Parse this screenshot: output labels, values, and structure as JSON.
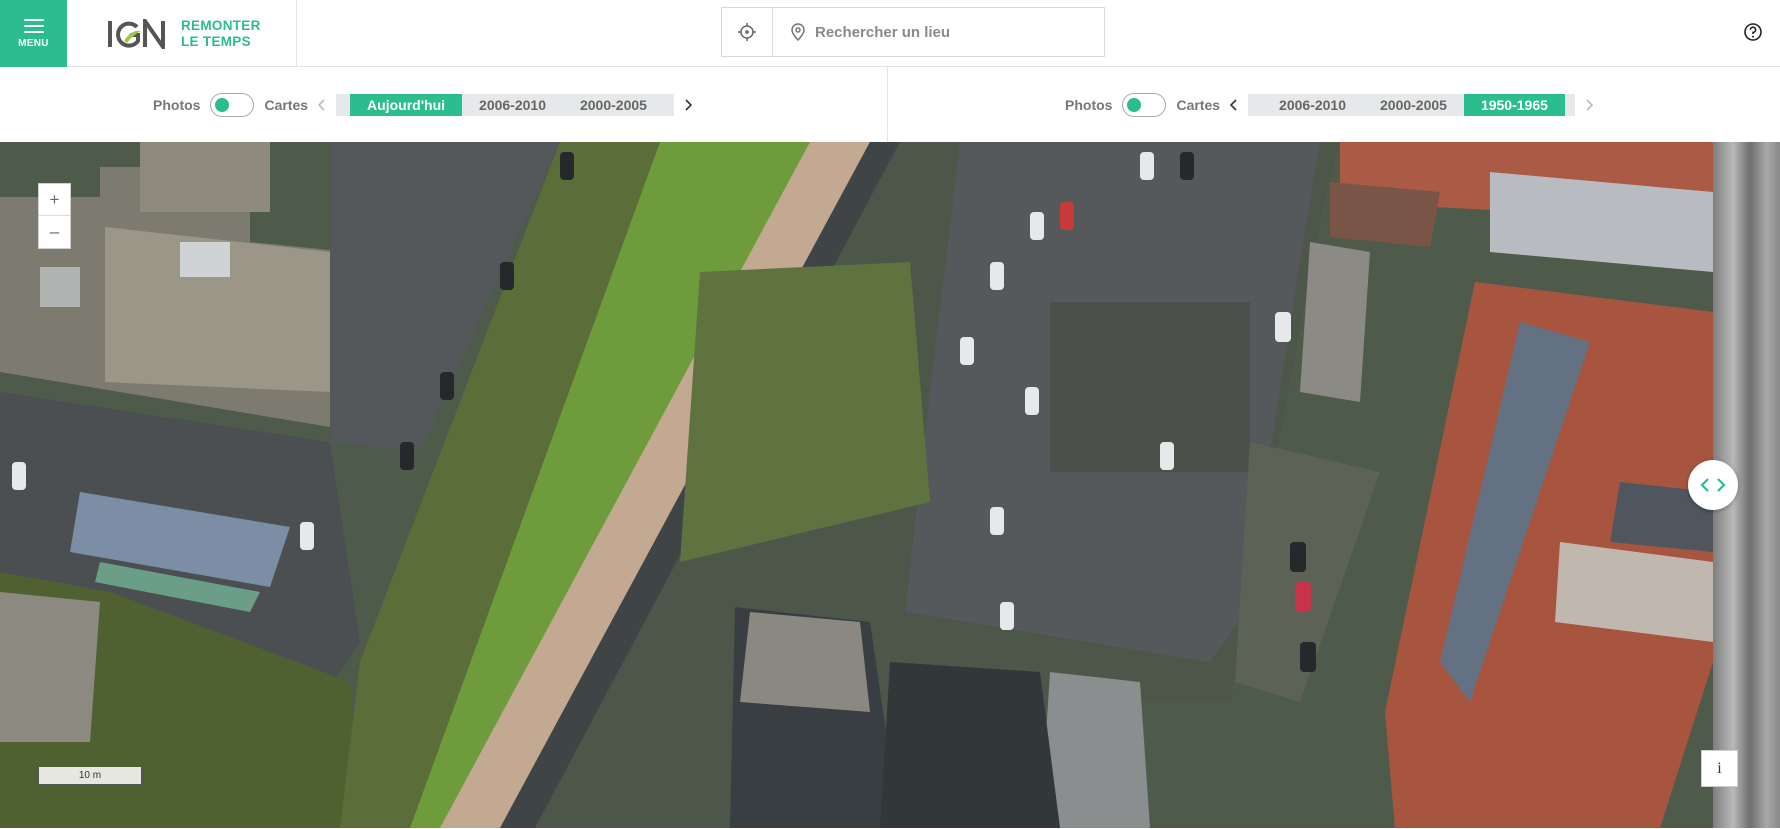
{
  "header": {
    "menu_label": "MENU",
    "brand_line1": "REMONTER",
    "brand_line2": "LE TEMPS",
    "logo_icon": "ign-logo-icon",
    "search_placeholder": "Rechercher un lieu",
    "locate_icon": "crosshair-icon",
    "search_icon": "location-pin-icon",
    "help_icon": "help-circle-icon"
  },
  "left_pane": {
    "photos_label": "Photos",
    "maps_label": "Cartes",
    "periods": [
      {
        "label": "Aujourd'hui",
        "active": true
      },
      {
        "label": "2006-2010",
        "active": false
      },
      {
        "label": "2000-2005",
        "active": false
      }
    ]
  },
  "right_pane": {
    "photos_label": "Photos",
    "maps_label": "Cartes",
    "periods": [
      {
        "label": "2006-2010",
        "active": false
      },
      {
        "label": "2000-2005",
        "active": false
      },
      {
        "label": "1950-1965",
        "active": true
      }
    ]
  },
  "map": {
    "zoom_in": "+",
    "zoom_out": "–",
    "scale_label": "10 m",
    "info_label": "i",
    "swipe_icon": "swipe-arrows-icon"
  },
  "colors": {
    "accent": "#2bbd8e",
    "text_muted": "#777777",
    "period_bg": "#e6e8ea"
  }
}
